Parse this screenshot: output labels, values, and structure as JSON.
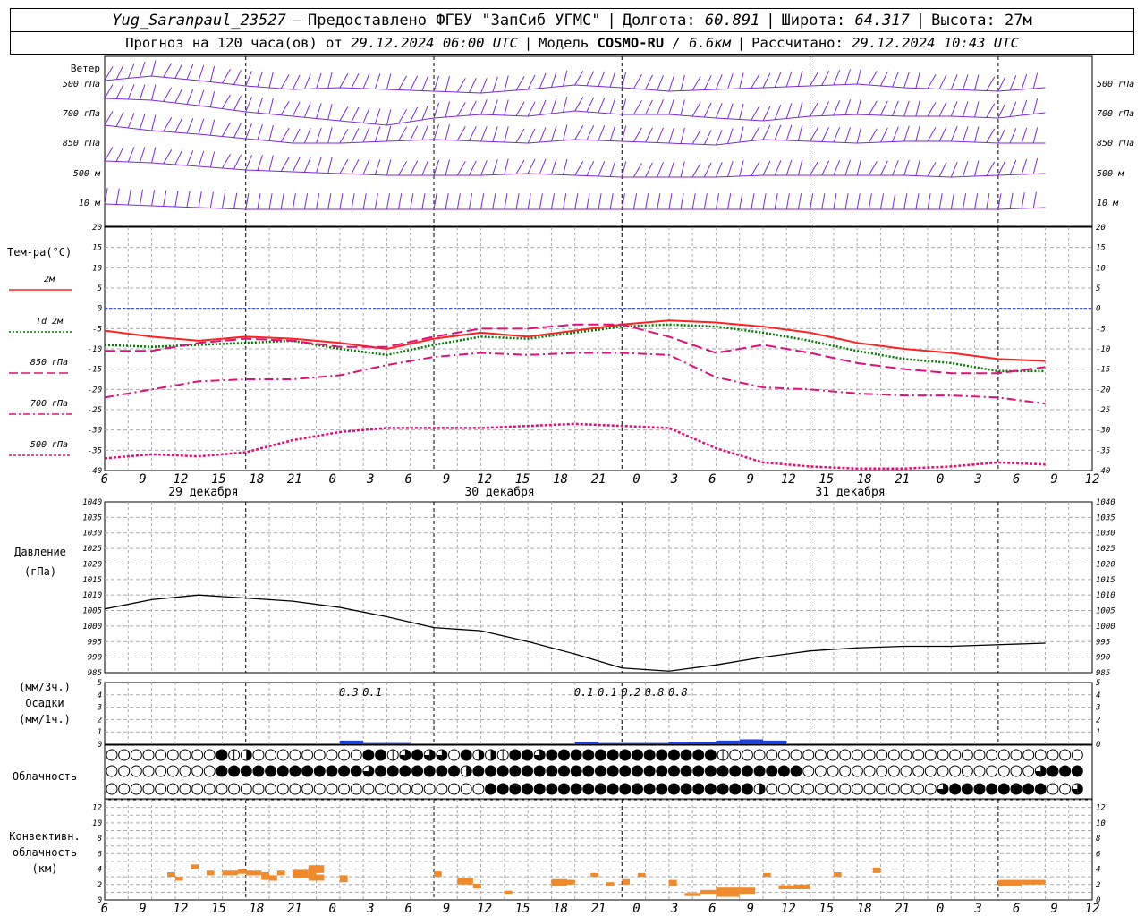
{
  "header": {
    "station": "Yug_Saranpaul_23527",
    "dash": "–",
    "provider": "Предоставлено ФГБУ \"ЗапСиб УГМС\"",
    "lon_label": "Долгота:",
    "lon_value": "60.891",
    "lat_label": "Широта:",
    "lat_value": "64.317",
    "alt_label": "Высота:",
    "alt_value": "27м",
    "forecast_label": "Прогноз на 120 часа(ов) от",
    "forecast_time": "29.12.2024 06:00 UTC",
    "model_label": "Модель",
    "model_name": "COSMO-RU",
    "model_res": "/ 6.6км",
    "calc_label": "Рассчитано:",
    "calc_time": "29.12.2024 10:43 UTC"
  },
  "labels": {
    "wind": "Ветер",
    "wind_levels": [
      "500 гПа",
      "700 гПа",
      "850 гПа",
      "500 м",
      "10 м"
    ],
    "temp": "Тем-ра(°С)",
    "legend": [
      {
        "label": "2м",
        "color": "#ff2020",
        "dash": "solid"
      },
      {
        "label": "Td 2м",
        "color": "#007700",
        "dash": "dot"
      },
      {
        "label": "850 гПа",
        "color": "#e0107a",
        "dash": "long"
      },
      {
        "label": "700 гПа",
        "color": "#e0107a",
        "dash": "dashdot"
      },
      {
        "label": "500 гПа",
        "color": "#e0107a",
        "dash": "dense"
      }
    ],
    "pressure": [
      "Давление",
      "(гПа)"
    ],
    "precip": [
      "(мм/3ч.)",
      "Осадки",
      "(мм/1ч.)"
    ],
    "cloud": "Облачность",
    "conv": [
      "Конвективн.",
      "облачность",
      "(км)"
    ],
    "days": [
      "29 декабря",
      "30 декабря",
      "31 декабря"
    ]
  },
  "axes": {
    "hour_ticks": [
      "6",
      "9",
      "12",
      "15",
      "18",
      "21",
      "0",
      "3",
      "6",
      "9",
      "12",
      "15",
      "18",
      "21",
      "0",
      "3",
      "6",
      "9",
      "12",
      "15",
      "18",
      "21",
      "0",
      "3",
      "6",
      "9",
      "12"
    ],
    "temp_ticks": [
      "20",
      "15",
      "10",
      "5",
      "0",
      "-5",
      "-10",
      "-15",
      "-20",
      "-25",
      "-30",
      "-35",
      "-40"
    ],
    "pressure_ticks": [
      "1040",
      "1035",
      "1030",
      "1025",
      "1020",
      "1015",
      "1010",
      "1005",
      "1000",
      "995",
      "990",
      "985"
    ],
    "precip_ticks": [
      "5",
      "4",
      "3",
      "2",
      "1",
      "0"
    ],
    "conv_ticks": [
      "12",
      "10",
      "8",
      "6",
      "4",
      "2",
      "0"
    ]
  },
  "chart_data": {
    "type": "line",
    "x_hours": [
      0,
      6,
      12,
      18,
      24,
      30,
      36,
      42,
      48,
      54,
      60,
      66,
      72,
      78,
      84,
      90,
      96,
      102,
      108,
      114,
      120
    ],
    "temperature": {
      "ylim": [
        -40,
        20
      ],
      "series": [
        {
          "name": "2м",
          "values": [
            -5.5,
            -7,
            -8,
            -7,
            -7.5,
            -8.5,
            -10,
            -7.5,
            -6,
            -7,
            -5.5,
            -4,
            -3,
            -3.5,
            -4.5,
            -6,
            -8.5,
            -10,
            -11,
            -12.5,
            -13
          ]
        },
        {
          "name": "Td 2м",
          "values": [
            -9,
            -9.5,
            -9,
            -8.5,
            -8,
            -10,
            -11.5,
            -9,
            -7,
            -7.5,
            -6,
            -4.5,
            -4,
            -4.5,
            -6,
            -8,
            -10.5,
            -12.5,
            -13.5,
            -15.5,
            -15.5
          ]
        },
        {
          "name": "850 гПа",
          "values": [
            -10.5,
            -10.5,
            -8.5,
            -7.5,
            -8,
            -9.5,
            -9.5,
            -7,
            -5,
            -5,
            -4,
            -4,
            -7,
            -11,
            -9,
            -11,
            -13.5,
            -15,
            -16,
            -16,
            -14.5
          ]
        },
        {
          "name": "700 гПа",
          "values": [
            -22,
            -20,
            -18,
            -17.5,
            -17.5,
            -16.5,
            -14,
            -12,
            -11,
            -11.5,
            -11,
            -11,
            -11.5,
            -17,
            -19.5,
            -20,
            -21,
            -21.5,
            -21.5,
            -22,
            -23.5
          ]
        },
        {
          "name": "500 гПа",
          "values": [
            -37,
            -36,
            -36.5,
            -35.5,
            -32.5,
            -30.5,
            -29.5,
            -29.5,
            -29.5,
            -29,
            -28.5,
            -29,
            -29.5,
            -34.5,
            -38,
            -39,
            -39.5,
            -39.5,
            -39,
            -38,
            -38.5
          ]
        }
      ]
    },
    "pressure": {
      "ylim": [
        985,
        1040
      ],
      "values": [
        1005.5,
        1008.5,
        1010,
        1009,
        1008,
        1006,
        1003,
        999.5,
        998.5,
        995,
        991,
        986.5,
        985.5,
        987.5,
        990,
        992,
        993,
        993.5,
        993.5,
        994,
        994.5
      ]
    },
    "precipitation": {
      "ylim": [
        0,
        5
      ],
      "bar_hours": [
        30,
        33,
        36,
        60,
        63,
        66,
        69,
        72,
        75,
        78,
        81,
        84
      ],
      "bar_values": [
        0.3,
        0.1,
        0.1,
        0.2,
        0.1,
        0.1,
        0.1,
        0.15,
        0.2,
        0.3,
        0.4,
        0.3
      ],
      "annotations": [
        {
          "hour": 30,
          "label": "0.3"
        },
        {
          "hour": 33,
          "label": "0.1"
        },
        {
          "hour": 60,
          "label": "0.1"
        },
        {
          "hour": 63,
          "label": "0.1"
        },
        {
          "hour": 66,
          "label": "0.2"
        },
        {
          "hour": 69,
          "label": "0.8"
        },
        {
          "hour": 72,
          "label": "0.8"
        }
      ]
    },
    "cloud_rows": [
      "000000000412000000000441343314221443444444444444441000000000000000000000000000",
      "000000000444444444444344444442444444444444444444444444444000000000000000000034444",
      "000000000000000000000000000000044444444444444444444442000000000000003444444440034444"
    ],
    "convective": {
      "ylim": [
        0,
        13
      ],
      "segments": [
        {
          "h": 26,
          "w": 1,
          "bottom": 3,
          "top": 4.5
        },
        {
          "h": 27,
          "w": 1,
          "bottom": 3.5,
          "top": 4.5
        },
        {
          "h": 26,
          "w": 2,
          "bottom": 2.5,
          "top": 3.3
        },
        {
          "h": 30,
          "w": 1,
          "bottom": 2.3,
          "top": 3.2
        },
        {
          "h": 45,
          "w": 2,
          "bottom": 2.0,
          "top": 2.9
        },
        {
          "h": 47,
          "w": 1,
          "bottom": 1.5,
          "top": 2.1
        },
        {
          "h": 51,
          "w": 1,
          "bottom": 0.8,
          "top": 1.2
        },
        {
          "h": 57,
          "w": 2,
          "bottom": 1.8,
          "top": 2.7
        },
        {
          "h": 59,
          "w": 1,
          "bottom": 2.0,
          "top": 2.6
        },
        {
          "h": 62,
          "w": 1,
          "bottom": 3.0,
          "top": 3.5
        },
        {
          "h": 64,
          "w": 1,
          "bottom": 1.8,
          "top": 2.3
        },
        {
          "h": 66,
          "w": 1,
          "bottom": 2.0,
          "top": 2.7
        },
        {
          "h": 68,
          "w": 1,
          "bottom": 3.0,
          "top": 3.5
        },
        {
          "h": 72,
          "w": 1,
          "bottom": 1.8,
          "top": 2.6
        },
        {
          "h": 86,
          "w": 2,
          "bottom": 1.4,
          "top": 1.9
        },
        {
          "h": 88,
          "w": 2,
          "bottom": 1.4,
          "top": 2.0
        },
        {
          "h": 114,
          "w": 3,
          "bottom": 1.8,
          "top": 2.6
        },
        {
          "h": 117,
          "w": 3,
          "bottom": 2.0,
          "top": 2.6
        },
        {
          "h": 20,
          "w": 1,
          "bottom": 2.6,
          "top": 3.6
        },
        {
          "h": 22,
          "w": 1,
          "bottom": 3.2,
          "top": 3.8
        },
        {
          "h": 24,
          "w": 2,
          "bottom": 2.8,
          "top": 3.9
        },
        {
          "h": 42,
          "w": 1,
          "bottom": 3.0,
          "top": 3.7
        },
        {
          "h": 8,
          "w": 1,
          "bottom": 3.0,
          "top": 3.6
        },
        {
          "h": 9,
          "w": 1,
          "bottom": 2.5,
          "top": 3.0
        },
        {
          "h": 11,
          "w": 1,
          "bottom": 4.0,
          "top": 4.6
        },
        {
          "h": 13,
          "w": 1,
          "bottom": 3.2,
          "top": 3.8
        },
        {
          "h": 15,
          "w": 2,
          "bottom": 3.2,
          "top": 3.8
        },
        {
          "h": 17,
          "w": 1,
          "bottom": 3.4,
          "top": 4.0
        },
        {
          "h": 18,
          "w": 2,
          "bottom": 3.2,
          "top": 3.8
        },
        {
          "h": 21,
          "w": 1,
          "bottom": 2.5,
          "top": 3.2
        },
        {
          "h": 74,
          "w": 2,
          "bottom": 0.5,
          "top": 0.9
        },
        {
          "h": 76,
          "w": 2,
          "bottom": 0.8,
          "top": 1.3
        },
        {
          "h": 78,
          "w": 3,
          "bottom": 0.4,
          "top": 1.6
        },
        {
          "h": 81,
          "w": 2,
          "bottom": 0.8,
          "top": 1.6
        },
        {
          "h": 84,
          "w": 1,
          "bottom": 3.0,
          "top": 3.5
        },
        {
          "h": 93,
          "w": 1,
          "bottom": 3.0,
          "top": 3.6
        },
        {
          "h": 98,
          "w": 1,
          "bottom": 3.5,
          "top": 4.2
        }
      ]
    }
  }
}
